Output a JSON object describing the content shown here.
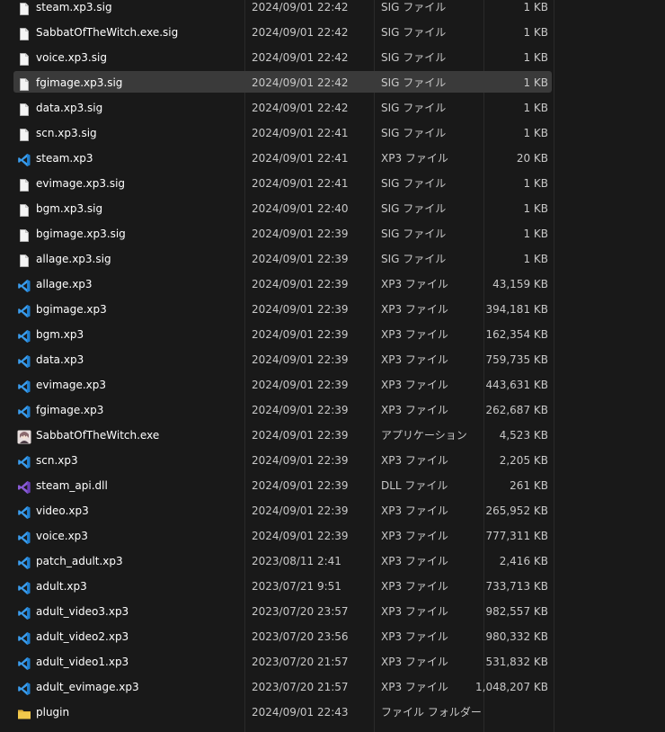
{
  "files": [
    {
      "name": "steam.xp3.sig",
      "date": "2024/09/01 22:42",
      "type": "SIG ファイル",
      "size": "1 KB",
      "icon": "file-icon"
    },
    {
      "name": "SabbatOfTheWitch.exe.sig",
      "date": "2024/09/01 22:42",
      "type": "SIG ファイル",
      "size": "1 KB",
      "icon": "file-icon"
    },
    {
      "name": "voice.xp3.sig",
      "date": "2024/09/01 22:42",
      "type": "SIG ファイル",
      "size": "1 KB",
      "icon": "file-icon"
    },
    {
      "name": "fgimage.xp3.sig",
      "date": "2024/09/01 22:42",
      "type": "SIG ファイル",
      "size": "1 KB",
      "icon": "file-icon",
      "selected": true
    },
    {
      "name": "data.xp3.sig",
      "date": "2024/09/01 22:42",
      "type": "SIG ファイル",
      "size": "1 KB",
      "icon": "file-icon"
    },
    {
      "name": "scn.xp3.sig",
      "date": "2024/09/01 22:41",
      "type": "SIG ファイル",
      "size": "1 KB",
      "icon": "file-icon"
    },
    {
      "name": "steam.xp3",
      "date": "2024/09/01 22:41",
      "type": "XP3 ファイル",
      "size": "20 KB",
      "icon": "vscode-icon"
    },
    {
      "name": "evimage.xp3.sig",
      "date": "2024/09/01 22:41",
      "type": "SIG ファイル",
      "size": "1 KB",
      "icon": "file-icon"
    },
    {
      "name": "bgm.xp3.sig",
      "date": "2024/09/01 22:40",
      "type": "SIG ファイル",
      "size": "1 KB",
      "icon": "file-icon"
    },
    {
      "name": "bgimage.xp3.sig",
      "date": "2024/09/01 22:39",
      "type": "SIG ファイル",
      "size": "1 KB",
      "icon": "file-icon"
    },
    {
      "name": "allage.xp3.sig",
      "date": "2024/09/01 22:39",
      "type": "SIG ファイル",
      "size": "1 KB",
      "icon": "file-icon"
    },
    {
      "name": "allage.xp3",
      "date": "2024/09/01 22:39",
      "type": "XP3 ファイル",
      "size": "43,159 KB",
      "icon": "vscode-icon"
    },
    {
      "name": "bgimage.xp3",
      "date": "2024/09/01 22:39",
      "type": "XP3 ファイル",
      "size": "394,181 KB",
      "icon": "vscode-icon"
    },
    {
      "name": "bgm.xp3",
      "date": "2024/09/01 22:39",
      "type": "XP3 ファイル",
      "size": "162,354 KB",
      "icon": "vscode-icon"
    },
    {
      "name": "data.xp3",
      "date": "2024/09/01 22:39",
      "type": "XP3 ファイル",
      "size": "759,735 KB",
      "icon": "vscode-icon"
    },
    {
      "name": "evimage.xp3",
      "date": "2024/09/01 22:39",
      "type": "XP3 ファイル",
      "size": "443,631 KB",
      "icon": "vscode-icon"
    },
    {
      "name": "fgimage.xp3",
      "date": "2024/09/01 22:39",
      "type": "XP3 ファイル",
      "size": "262,687 KB",
      "icon": "vscode-icon"
    },
    {
      "name": "SabbatOfTheWitch.exe",
      "date": "2024/09/01 22:39",
      "type": "アプリケーション",
      "size": "4,523 KB",
      "icon": "app-icon"
    },
    {
      "name": "scn.xp3",
      "date": "2024/09/01 22:39",
      "type": "XP3 ファイル",
      "size": "2,205 KB",
      "icon": "vscode-icon"
    },
    {
      "name": "steam_api.dll",
      "date": "2024/09/01 22:39",
      "type": "DLL ファイル",
      "size": "261 KB",
      "icon": "visual-studio-icon"
    },
    {
      "name": "video.xp3",
      "date": "2024/09/01 22:39",
      "type": "XP3 ファイル",
      "size": "265,952 KB",
      "icon": "vscode-icon"
    },
    {
      "name": "voice.xp3",
      "date": "2024/09/01 22:39",
      "type": "XP3 ファイル",
      "size": "777,311 KB",
      "icon": "vscode-icon"
    },
    {
      "name": "patch_adult.xp3",
      "date": "2023/08/11 2:41",
      "type": "XP3 ファイル",
      "size": "2,416 KB",
      "icon": "vscode-icon"
    },
    {
      "name": "adult.xp3",
      "date": "2023/07/21 9:51",
      "type": "XP3 ファイル",
      "size": "733,713 KB",
      "icon": "vscode-icon"
    },
    {
      "name": "adult_video3.xp3",
      "date": "2023/07/20 23:57",
      "type": "XP3 ファイル",
      "size": "982,557 KB",
      "icon": "vscode-icon"
    },
    {
      "name": "adult_video2.xp3",
      "date": "2023/07/20 23:56",
      "type": "XP3 ファイル",
      "size": "980,332 KB",
      "icon": "vscode-icon"
    },
    {
      "name": "adult_video1.xp3",
      "date": "2023/07/20 21:57",
      "type": "XP3 ファイル",
      "size": "531,832 KB",
      "icon": "vscode-icon"
    },
    {
      "name": "adult_evimage.xp3",
      "date": "2023/07/20 21:57",
      "type": "XP3 ファイル",
      "size": "1,048,207 KB",
      "icon": "vscode-icon"
    },
    {
      "name": "plugin",
      "date": "2024/09/01 22:43",
      "type": "ファイル フォルダー",
      "size": "",
      "icon": "folder-icon"
    }
  ],
  "colors": {
    "background": "#191919",
    "selected_row": "#3a3a3a",
    "vscode_blue": "#3b9ded",
    "visual_studio_purple": "#8a5bd6",
    "folder_yellow": "#f2c94c"
  }
}
